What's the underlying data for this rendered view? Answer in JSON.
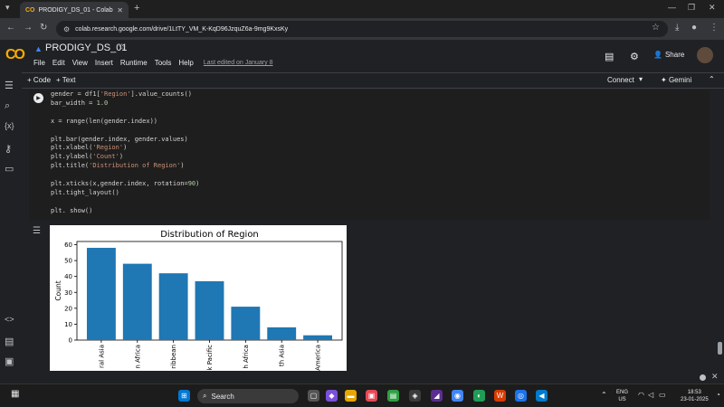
{
  "browser": {
    "tab_title": "PRODIGY_DS_01 - Colab",
    "tab_icon_text": "CO",
    "url": "colab.research.google.com/drive/1LtTY_VM_K-KqD96JzquZ6a-9mg9KxsKy"
  },
  "colab": {
    "logo_text": "CO",
    "notebook_title": "PRODIGY_DS_01",
    "menu": [
      "File",
      "Edit",
      "View",
      "Insert",
      "Runtime",
      "Tools",
      "Help"
    ],
    "last_edited": "Last edited on January 8",
    "share_label": "Share",
    "add_code_label": "+ Code",
    "add_text_label": "+ Text",
    "connect_label": "Connect",
    "gemini_label": "Gemini"
  },
  "cell": {
    "code_lines": [
      "gender = df1['Region'].value_counts()",
      "bar_width = 1.0",
      "",
      "x = range(len(gender.index))",
      "",
      "plt.bar(gender.index, gender.values)",
      "plt.xlabel('Region')",
      "plt.ylabel('Count')",
      "plt.title('Distribution of Region')",
      "",
      "plt.xticks(x,gender.index, rotation=90)",
      "plt.tight_layout()",
      "",
      "plt. show()"
    ]
  },
  "chart_data": {
    "type": "bar",
    "title": "Distribution of Region",
    "xlabel": "",
    "ylabel": "Count",
    "categories": [
      "ral Asia",
      "n Africa",
      "ribbean",
      "k Pacific",
      "h Africa",
      "th Asia",
      "America"
    ],
    "values": [
      58,
      48,
      42,
      37,
      21,
      8,
      3
    ],
    "yticks": [
      0,
      10,
      20,
      30,
      40,
      50,
      60
    ],
    "ylim": [
      0,
      62
    ],
    "bar_color": "#1f77b4",
    "grid": false
  },
  "taskbar": {
    "search_label": "Search",
    "lang_line1": "ENG",
    "lang_line2": "US",
    "time": "18:53",
    "date": "23-01-2025"
  }
}
